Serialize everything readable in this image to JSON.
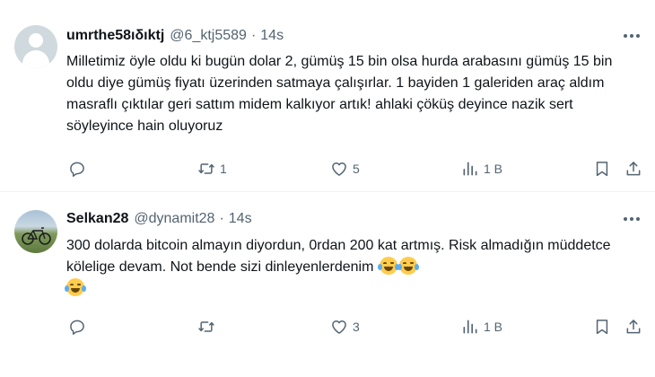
{
  "tweets": [
    {
      "display_name": "umrthe58ıδıktj",
      "handle": "@6_ktj5589",
      "separator": "·",
      "time": "14s",
      "avatar": "default-avatar",
      "text": "Milletimiz öyle oldu ki bugün dolar 2, gümüş 15 bin olsa hurda arabasını gümüş 15 bin oldu diye gümüş fiyatı üzerinden satmaya çalışırlar. 1 bayiden 1 galeriden araç aldım masraflı çıktılar geri sattım midem kalkıyor artık! ahlaki çöküş deyince nazik sert söyleyince hain oluyoruz",
      "emojis": [],
      "actions": {
        "replies": "",
        "retweets": "1",
        "likes": "5",
        "views": "1 B"
      }
    },
    {
      "display_name": "Selkan28",
      "handle": "@dynamit28",
      "separator": "·",
      "time": "14s",
      "avatar": "bicycle-photo",
      "text": "300 dolarda bitcoin almayın diyordun, 0rdan 200 kat artmış. Risk almadığın müddetce kölelige devam. Not bende sizi dinleyenlerdenim ",
      "emojis": [
        "face-with-tears-of-joy",
        "face-with-tears-of-joy",
        "face-with-tears-of-joy"
      ],
      "actions": {
        "replies": "",
        "retweets": "",
        "likes": "3",
        "views": "1 B"
      }
    }
  ],
  "icons": {
    "more": "more-icon",
    "reply": "reply-icon",
    "retweet": "retweet-icon",
    "like": "heart-icon",
    "views": "views-icon",
    "bookmark": "bookmark-icon",
    "share": "share-icon"
  },
  "colors": {
    "text": "#0f1419",
    "secondary": "#536471",
    "divider": "#eff3f4",
    "background": "#ffffff"
  }
}
